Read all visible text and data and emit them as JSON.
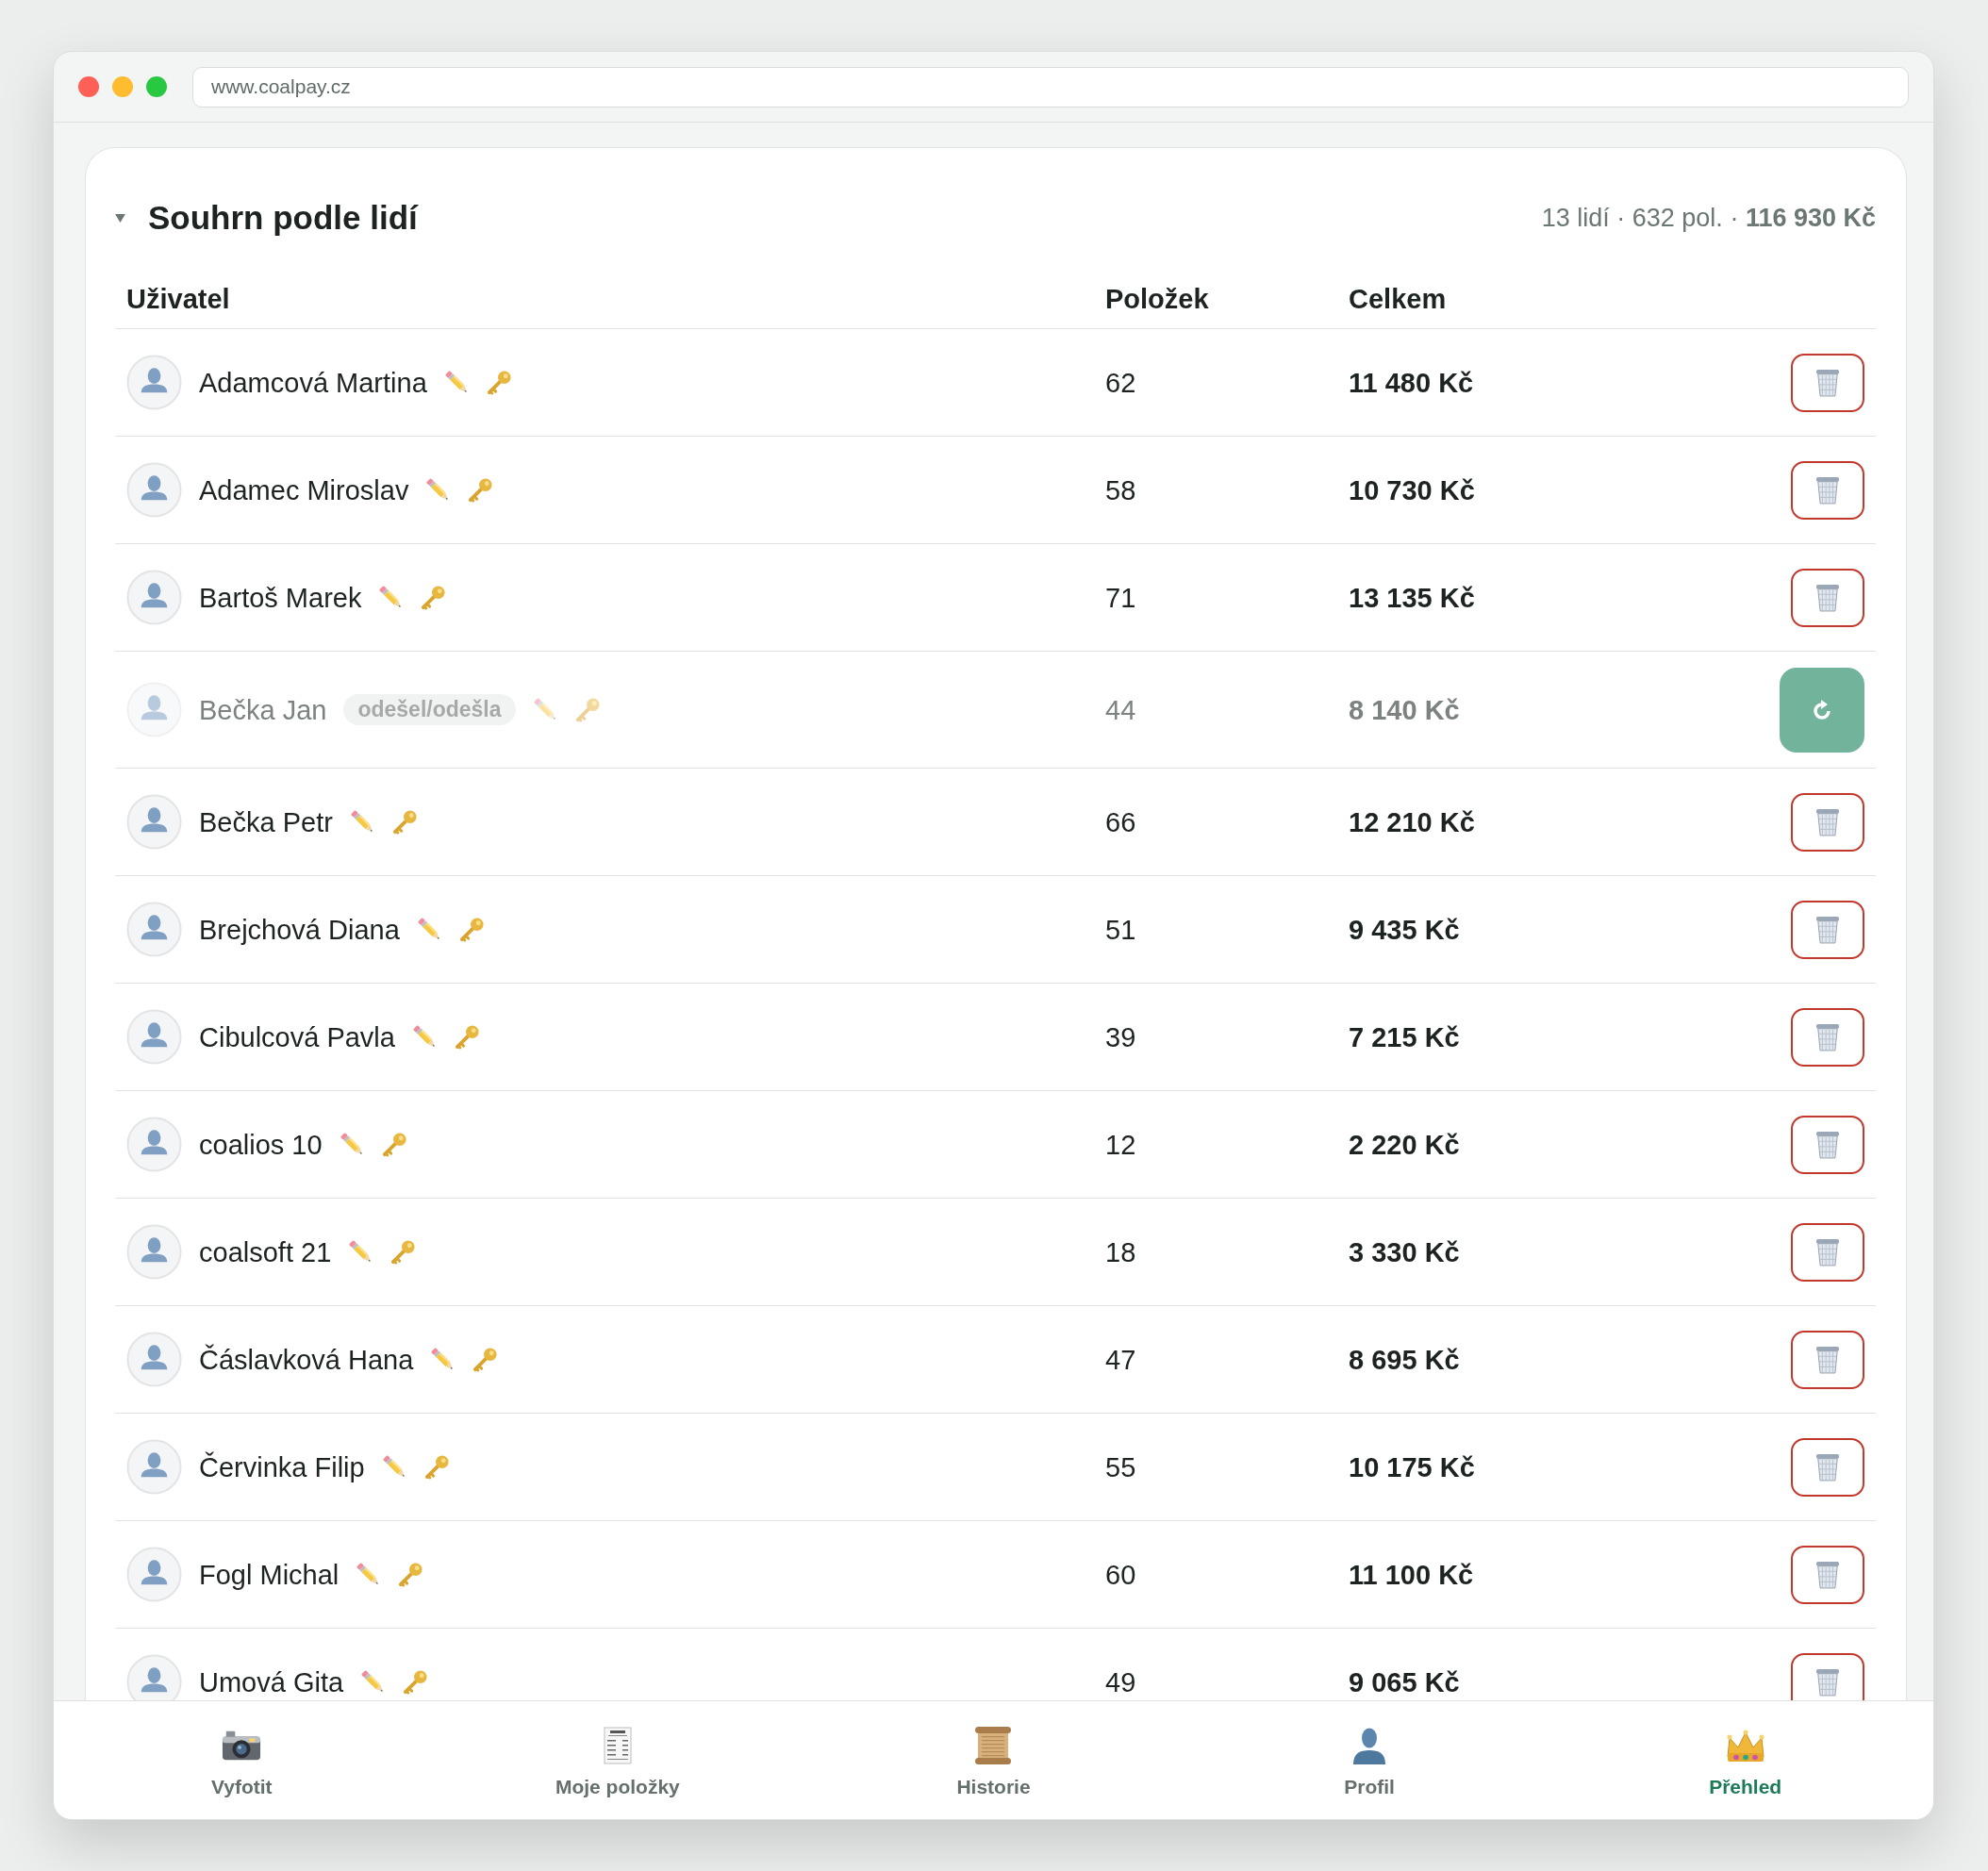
{
  "browser": {
    "url": "www.coalpay.cz"
  },
  "summary": {
    "title": "Souhrn podle lidí",
    "expanded": true,
    "stats": "13 lidí · 632 pol. · **116 930 Kč**"
  },
  "table": {
    "columns": [
      "Uživatel",
      "Položek",
      "Celkem"
    ],
    "rows": [
      {
        "name": "Adamcová Martina",
        "items": "62",
        "total": "11 480 Kč",
        "departed": false
      },
      {
        "name": "Adamec Miroslav",
        "items": "58",
        "total": "10 730 Kč",
        "departed": false
      },
      {
        "name": "Bartoš Marek",
        "items": "71",
        "total": "13 135 Kč",
        "departed": false
      },
      {
        "name": "Bečka Jan",
        "badge": "odešel/odešla",
        "items": "44",
        "total": "8 140 Kč",
        "departed": true
      },
      {
        "name": "Bečka Petr",
        "items": "66",
        "total": "12 210 Kč",
        "departed": false
      },
      {
        "name": "Brejchová Diana",
        "items": "51",
        "total": "9 435 Kč",
        "departed": false
      },
      {
        "name": "Cibulcová Pavla",
        "items": "39",
        "total": "7 215 Kč",
        "departed": false
      },
      {
        "name": "coalios 10",
        "items": "12",
        "total": "2 220 Kč",
        "departed": false
      },
      {
        "name": "coalsoft 21",
        "items": "18",
        "total": "3 330 Kč",
        "departed": false
      },
      {
        "name": "Čáslavková Hana",
        "items": "47",
        "total": "8 695 Kč",
        "departed": false
      },
      {
        "name": "Červinka Filip",
        "items": "55",
        "total": "10 175 Kč",
        "departed": false
      },
      {
        "name": "Fogl Michal",
        "items": "60",
        "total": "11 100 Kč",
        "departed": false
      },
      {
        "name": "Umová Gita",
        "items": "49",
        "total": "9 065 Kč",
        "departed": false
      }
    ]
  },
  "nav": {
    "items": [
      {
        "label": "Vyfotit",
        "selected": false
      },
      {
        "label": "Moje položky",
        "selected": false
      },
      {
        "label": "Historie",
        "selected": false
      },
      {
        "label": "Profil",
        "selected": false
      },
      {
        "label": "Přehled",
        "selected": true
      }
    ]
  }
}
